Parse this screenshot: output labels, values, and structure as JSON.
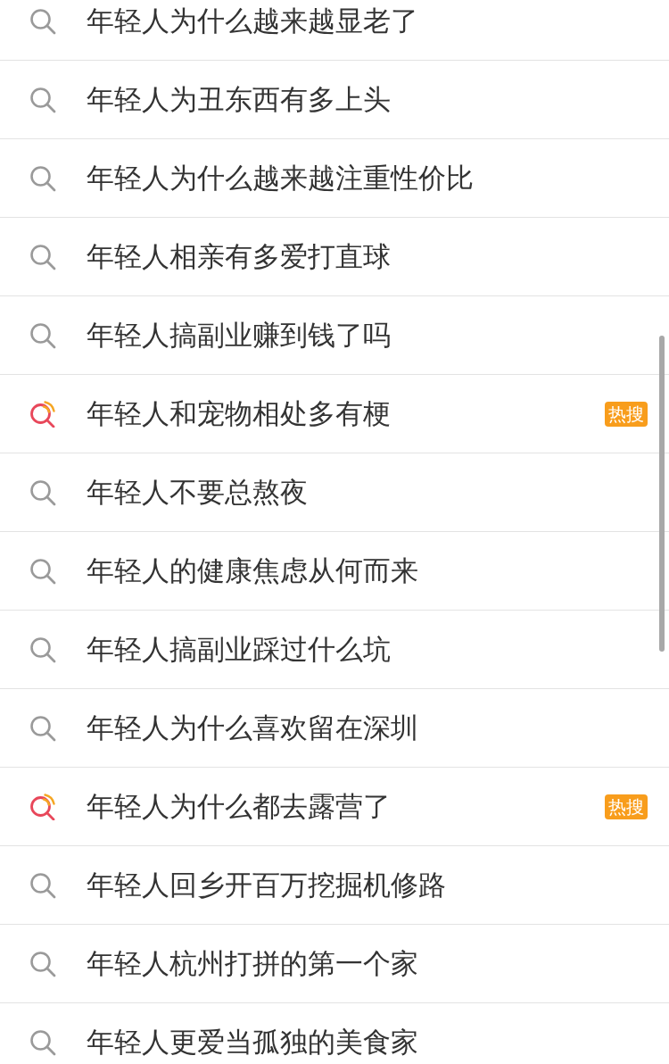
{
  "suggestions": [
    {
      "text": "年轻人为什么越来越显老了",
      "kind": "normal"
    },
    {
      "text": "年轻人为丑东西有多上头",
      "kind": "normal"
    },
    {
      "text": "年轻人为什么越来越注重性价比",
      "kind": "normal"
    },
    {
      "text": "年轻人相亲有多爱打直球",
      "kind": "normal"
    },
    {
      "text": "年轻人搞副业赚到钱了吗",
      "kind": "normal"
    },
    {
      "text": "年轻人和宠物相处多有梗",
      "kind": "hot",
      "badge": "热搜"
    },
    {
      "text": "年轻人不要总熬夜",
      "kind": "normal"
    },
    {
      "text": "年轻人的健康焦虑从何而来",
      "kind": "normal"
    },
    {
      "text": "年轻人搞副业踩过什么坑",
      "kind": "normal"
    },
    {
      "text": "年轻人为什么喜欢留在深圳",
      "kind": "normal"
    },
    {
      "text": "年轻人为什么都去露营了",
      "kind": "hot",
      "badge": "热搜"
    },
    {
      "text": "年轻人回乡开百万挖掘机修路",
      "kind": "normal"
    },
    {
      "text": "年轻人杭州打拼的第一个家",
      "kind": "normal"
    },
    {
      "text": "年轻人更爱当孤独的美食家",
      "kind": "normal"
    }
  ]
}
